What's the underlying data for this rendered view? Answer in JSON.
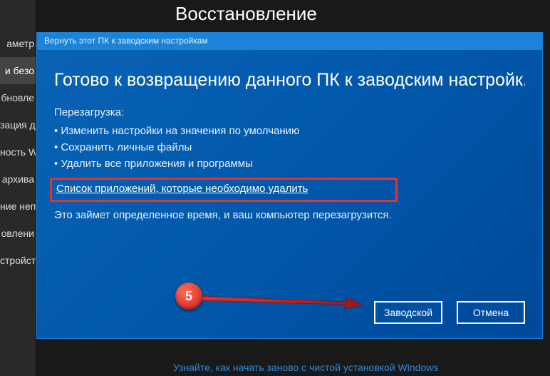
{
  "page": {
    "title": "Восстановление",
    "footer_link": "Узнайте, как начать заново с чистой установкой Windows"
  },
  "sidebar": {
    "items": [
      {
        "label": "аметр"
      },
      {
        "label": "и безо"
      },
      {
        "label": "бновле"
      },
      {
        "label": "зация д"
      },
      {
        "label": "ность W"
      },
      {
        "label": "архива"
      },
      {
        "label": "ние неп"
      },
      {
        "label": "овлени"
      },
      {
        "label": "стройсті"
      }
    ],
    "selected_index": 1
  },
  "dialog": {
    "titlebar": "Вернуть этот ПК к заводским настройкам",
    "heading": "Готово к возвращению данного ПК к заводским настройк...",
    "subheading": "Перезагрузка:",
    "bullets": [
      "Изменить настройки на значения по умолчанию",
      "Сохранить личные файлы",
      "Удалить все приложения и программы"
    ],
    "apps_link": "Список приложений, которые необходимо удалить",
    "note": "Это займет определенное время, и ваш компьютер перезагрузится.",
    "primary_button": "Заводской",
    "cancel_button": "Отмена"
  },
  "annotation": {
    "step_number": "5"
  }
}
